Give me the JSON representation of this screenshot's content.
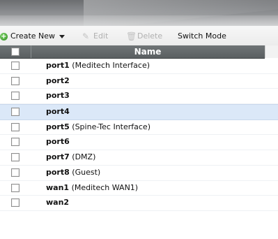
{
  "toolbar": {
    "create_new": "Create New",
    "edit": "Edit",
    "delete": "Delete",
    "switch_mode": "Switch Mode"
  },
  "table": {
    "header_name": "Name",
    "rows": [
      {
        "port": "port1",
        "desc": "(Meditech Interface)",
        "selected": false
      },
      {
        "port": "port2",
        "desc": "",
        "selected": false
      },
      {
        "port": "port3",
        "desc": "",
        "selected": false
      },
      {
        "port": "port4",
        "desc": "",
        "selected": true
      },
      {
        "port": "port5",
        "desc": "(Spine-Tec Interface)",
        "selected": false
      },
      {
        "port": "port6",
        "desc": "",
        "selected": false
      },
      {
        "port": "port7",
        "desc": "(DMZ)",
        "selected": false
      },
      {
        "port": "port8",
        "desc": "(Guest)",
        "selected": false
      },
      {
        "port": "wan1",
        "desc": "(Meditech WAN1)",
        "selected": false
      },
      {
        "port": "wan2",
        "desc": "",
        "selected": false
      }
    ]
  },
  "colors": {
    "header_bg": "#5f6466",
    "selected_row": "#dbe8f8",
    "disabled_text": "#b0b0b0",
    "create_icon": "#3aa12a"
  },
  "icons": {
    "create": "plus-circle-icon",
    "create_menu": "caret-down-icon",
    "edit": "pencil-icon",
    "delete": "trash-icon"
  }
}
